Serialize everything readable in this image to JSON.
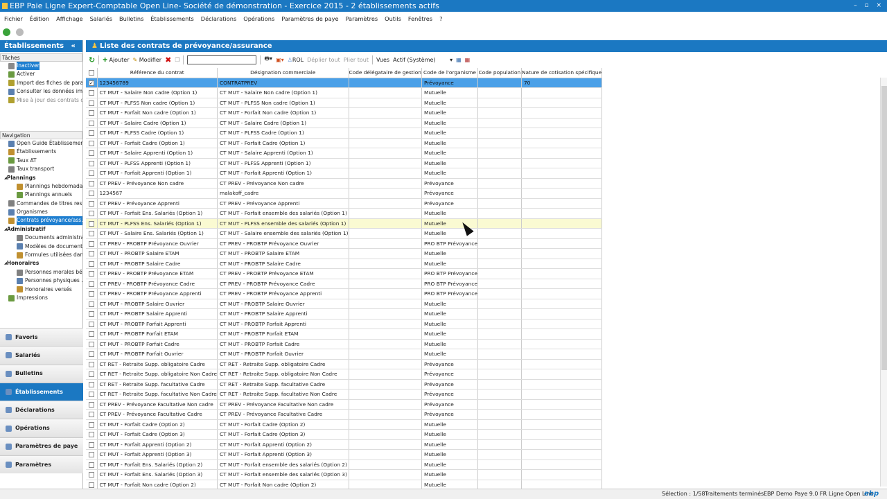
{
  "window": {
    "title": "EBP Paie Ligne Expert-Comptable Open Line- Société de démonstration - Exercice 2015 - 2 établissements actifs",
    "controls": "– ▫ ×"
  },
  "menu": [
    "Fichier",
    "Édition",
    "Affichage",
    "Salariés",
    "Bulletins",
    "Établissements",
    "Déclarations",
    "Opérations",
    "Paramètres de paye",
    "Paramètres",
    "Outils",
    "Fenêtres",
    "?"
  ],
  "left": {
    "title": "Établissements",
    "collapse": "«",
    "tasks_label": "Tâches",
    "tasks": [
      "Inactiver",
      "Activer",
      "Import des fiches de para...",
      "Consulter les données imp...",
      "Mise à jour des contrats d..."
    ],
    "nav_label": "Navigation",
    "nav": [
      {
        "label": "Open Guide Établissements",
        "lvl": 1
      },
      {
        "label": "Établissements",
        "lvl": 1
      },
      {
        "label": "Taux AT",
        "lvl": 1
      },
      {
        "label": "Taux transport",
        "lvl": 1
      },
      {
        "label": "Plannings",
        "lvl": 0
      },
      {
        "label": "Plannings hebdomadai...",
        "lvl": 2
      },
      {
        "label": "Plannings annuels",
        "lvl": 2
      },
      {
        "label": "Commandes de titres rest...",
        "lvl": 1
      },
      {
        "label": "Organismes",
        "lvl": 1
      },
      {
        "label": "Contrats prévoyance/ass...",
        "lvl": 1,
        "selected": true
      },
      {
        "label": "Administratif",
        "lvl": 0
      },
      {
        "label": "Documents administra...",
        "lvl": 2
      },
      {
        "label": "Modèles de document...",
        "lvl": 2
      },
      {
        "label": "Formules utilisées dan...",
        "lvl": 2
      },
      {
        "label": "Honoraires",
        "lvl": 0
      },
      {
        "label": "Personnes morales bé...",
        "lvl": 2
      },
      {
        "label": "Personnes physiques ...",
        "lvl": 2
      },
      {
        "label": "Honoraires versés",
        "lvl": 2
      },
      {
        "label": "Impressions",
        "lvl": 1
      }
    ],
    "modules": [
      "Favoris",
      "Salariés",
      "Bulletins",
      "Établissements",
      "Déclarations",
      "Opérations",
      "Paramètres de paye",
      "Paramètres"
    ],
    "active_module": "Établissements"
  },
  "main": {
    "title": "Liste des contrats de prévoyance/assurance",
    "toolbar": {
      "add": "Ajouter",
      "edit": "Modifier",
      "search_value": "",
      "rol": "ROL",
      "expand": "Déplier tout",
      "collapse": "Plier tout",
      "views": "Vues",
      "view_value": "Actif (Système)"
    },
    "columns": [
      "Référence du contrat",
      "Désignation commerciale",
      "Code délégataire de gestion",
      "Code de l'organisme",
      "Code population",
      "Nature de cotisation spécifique"
    ],
    "rows": [
      [
        "123456789",
        "CONTRATPREV",
        "",
        "Prévoyance",
        "",
        "70"
      ],
      [
        "CT MUT - Salaire Non cadre (Option 1)",
        "CT MUT - Salaire Non cadre (Option 1)",
        "",
        "Mutuelle",
        "",
        ""
      ],
      [
        "CT MUT - PLFSS Non cadre (Option 1)",
        "CT MUT - PLFSS Non cadre (Option 1)",
        "",
        "Mutuelle",
        "",
        ""
      ],
      [
        "CT MUT - Forfait Non cadre (Option 1)",
        "CT MUT - Forfait Non cadre (Option 1)",
        "",
        "Mutuelle",
        "",
        ""
      ],
      [
        "CT MUT - Salaire Cadre (Option 1)",
        "CT MUT - Salaire Cadre (Option 1)",
        "",
        "Mutuelle",
        "",
        ""
      ],
      [
        "CT MUT - PLFSS Cadre (Option 1)",
        "CT MUT - PLFSS Cadre (Option 1)",
        "",
        "Mutuelle",
        "",
        ""
      ],
      [
        "CT MUT - Forfait Cadre (Option 1)",
        "CT MUT - Forfait Cadre (Option 1)",
        "",
        "Mutuelle",
        "",
        ""
      ],
      [
        "CT MUT - Salaire Apprenti (Option 1)",
        "CT MUT - Salaire Apprenti (Option 1)",
        "",
        "Mutuelle",
        "",
        ""
      ],
      [
        "CT MUT - PLFSS Apprenti (Option 1)",
        "CT MUT - PLFSS Apprenti (Option 1)",
        "",
        "Mutuelle",
        "",
        ""
      ],
      [
        "CT MUT - Forfait Apprenti (Option 1)",
        "CT MUT - Forfait Apprenti (Option 1)",
        "",
        "Mutuelle",
        "",
        ""
      ],
      [
        "CT PREV - Prévoyance Non cadre",
        "CT PREV - Prévoyance Non cadre",
        "",
        "Prévoyance",
        "",
        ""
      ],
      [
        "1234567",
        "malakoff_cadre",
        "",
        "Prévoyance",
        "",
        ""
      ],
      [
        "CT PREV - Prévoyance Apprenti",
        "CT PREV - Prévoyance Apprenti",
        "",
        "Prévoyance",
        "",
        ""
      ],
      [
        "CT MUT - Forfait Ens. Salariés (Option 1)",
        "CT MUT - Forfait ensemble des salariés (Option 1)",
        "",
        "Mutuelle",
        "",
        ""
      ],
      [
        "CT MUT - PLFSS Ens. Salariés (Option 1)",
        "CT MUT - PLFSS ensemble des salariés (Option 1)",
        "",
        "Mutuelle",
        "",
        ""
      ],
      [
        "CT MUT - Salaire Ens. Salariés (Option 1)",
        "CT MUT - Salaire ensemble des salariés (Option 1)",
        "",
        "Mutuelle",
        "",
        ""
      ],
      [
        "CT PREV - PROBTP Prévoyance Ouvrier",
        "CT PREV - PROBTP Prévoyance Ouvrier",
        "",
        "PRO BTP Prévoyance",
        "",
        ""
      ],
      [
        "CT MUT - PROBTP Salaire ETAM",
        "CT MUT - PROBTP Salaire ETAM",
        "",
        "Mutuelle",
        "",
        ""
      ],
      [
        "CT MUT - PROBTP Salaire Cadre",
        "CT MUT - PROBTP Salaire Cadre",
        "",
        "Mutuelle",
        "",
        ""
      ],
      [
        "CT PREV - PROBTP Prévoyance ETAM",
        "CT PREV - PROBTP Prévoyance ETAM",
        "",
        "PRO BTP Prévoyance",
        "",
        ""
      ],
      [
        "CT PREV - PROBTP Prévoyance Cadre",
        "CT PREV - PROBTP Prévoyance Cadre",
        "",
        "PRO BTP Prévoyance",
        "",
        ""
      ],
      [
        "CT PREV - PROBTP Prévoyance Apprenti",
        "CT PREV - PROBTP Prévoyance Apprenti",
        "",
        "PRO BTP Prévoyance",
        "",
        ""
      ],
      [
        "CT MUT - PROBTP Salaire Ouvrier",
        "CT MUT - PROBTP Salaire Ouvrier",
        "",
        "Mutuelle",
        "",
        ""
      ],
      [
        "CT MUT - PROBTP Salaire Apprenti",
        "CT MUT - PROBTP Salaire Apprenti",
        "",
        "Mutuelle",
        "",
        ""
      ],
      [
        "CT MUT - PROBTP Forfait Apprenti",
        "CT MUT - PROBTP Forfait Apprenti",
        "",
        "Mutuelle",
        "",
        ""
      ],
      [
        "CT MUT - PROBTP Forfait ETAM",
        "CT MUT - PROBTP Forfait ETAM",
        "",
        "Mutuelle",
        "",
        ""
      ],
      [
        "CT MUT - PROBTP Forfait Cadre",
        "CT MUT - PROBTP Forfait Cadre",
        "",
        "Mutuelle",
        "",
        ""
      ],
      [
        "CT MUT - PROBTP Forfait Ouvrier",
        "CT MUT - PROBTP Forfait Ouvrier",
        "",
        "Mutuelle",
        "",
        ""
      ],
      [
        "CT RET - Retraite Supp. obligatoire Cadre",
        "CT RET - Retraite Supp. obligatoire Cadre",
        "",
        "Prévoyance",
        "",
        ""
      ],
      [
        "CT RET - Retraite Supp. obligatoire Non Cadre",
        "CT RET - Retraite Supp. obligatoire Non Cadre",
        "",
        "Prévoyance",
        "",
        ""
      ],
      [
        "CT RET - Retraite Supp. facultative Cadre",
        "CT RET - Retraite Supp. facultative Cadre",
        "",
        "Prévoyance",
        "",
        ""
      ],
      [
        "CT RET - Retraite Supp. facultative Non Cadre",
        "CT RET - Retraite Supp. facultative Non Cadre",
        "",
        "Prévoyance",
        "",
        ""
      ],
      [
        "CT PREV - Prévoyance Facultative Non cadre",
        "CT PREV - Prévoyance Facultative Non cadre",
        "",
        "Prévoyance",
        "",
        ""
      ],
      [
        "CT PREV - Prévoyance Facultative Cadre",
        "CT PREV - Prévoyance Facultative Cadre",
        "",
        "Prévoyance",
        "",
        ""
      ],
      [
        "CT MUT - Forfait Cadre (Option 2)",
        "CT MUT - Forfait Cadre (Option 2)",
        "",
        "Mutuelle",
        "",
        ""
      ],
      [
        "CT MUT - Forfait Cadre (Option 3)",
        "CT MUT - Forfait Cadre (Option 3)",
        "",
        "Mutuelle",
        "",
        ""
      ],
      [
        "CT MUT - Forfait Apprenti (Option 2)",
        "CT MUT - Forfait Apprenti (Option 2)",
        "",
        "Mutuelle",
        "",
        ""
      ],
      [
        "CT MUT - Forfait Apprenti (Option 3)",
        "CT MUT - Forfait Apprenti (Option 3)",
        "",
        "Mutuelle",
        "",
        ""
      ],
      [
        "CT MUT - Forfait Ens. Salariés (Option 2)",
        "CT MUT - Forfait ensemble des salariés (Option 2)",
        "",
        "Mutuelle",
        "",
        ""
      ],
      [
        "CT MUT - Forfait Ens. Salariés (Option 3)",
        "CT MUT - Forfait ensemble des salariés (Option 3)",
        "",
        "Mutuelle",
        "",
        ""
      ],
      [
        "CT MUT - Forfait Non cadre (Option 2)",
        "CT MUT - Forfait Non cadre (Option 2)",
        "",
        "Mutuelle",
        "",
        ""
      ]
    ],
    "selected_row": 0,
    "hover_row": 14
  },
  "status": {
    "selection": "Sélection : 1/58",
    "state": "Traitements terminés",
    "product": "EBP Demo Paye 9.0 FR Ligne Open Line",
    "logo": "ebp"
  },
  "colors": {
    "accent": "#1b78c2",
    "selection": "#4aa0e8",
    "hover": "#fafad2"
  }
}
